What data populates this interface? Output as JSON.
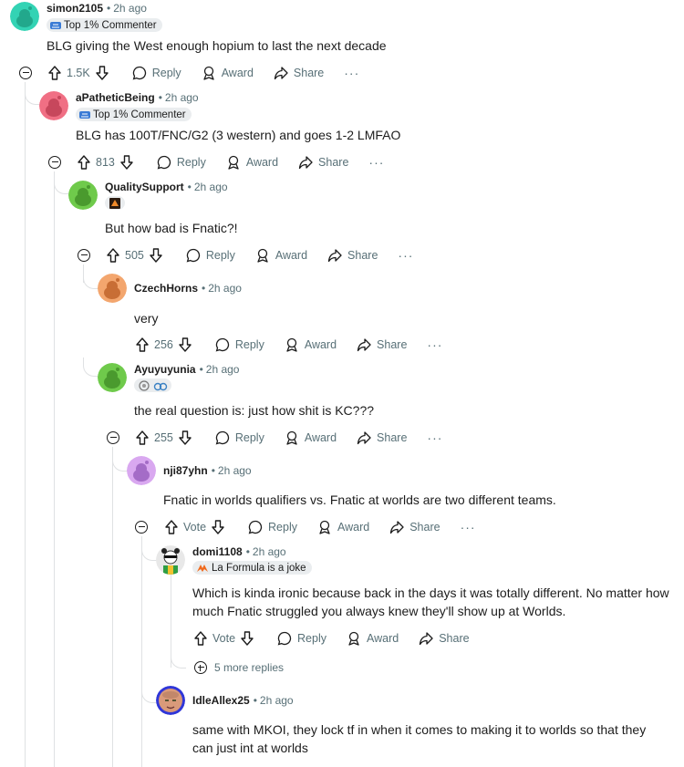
{
  "labels": {
    "reply": "Reply",
    "award": "Award",
    "share": "Share",
    "more": "···"
  },
  "comments": [
    {
      "user": "simon2105",
      "time": "2h ago",
      "flair": "Top 1% Commenter",
      "body": "BLG giving the West enough hopium to last the next decade",
      "votes": "1.5K",
      "avatar_color": "#33d3b4"
    },
    {
      "user": "aPatheticBeing",
      "time": "2h ago",
      "flair": "Top 1% Commenter",
      "body": "BLG has 100T/FNC/G2 (3 western) and goes 1-2 LMFAO",
      "votes": "813",
      "avatar_color": "#f06f84"
    },
    {
      "user": "QualitySupport",
      "time": "2h ago",
      "flair": "",
      "body": "But how bad is Fnatic?!",
      "votes": "505",
      "avatar_color": "#6fca4b"
    },
    {
      "user": "CzechHorns",
      "time": "2h ago",
      "flair": "",
      "body": "very",
      "votes": "256",
      "avatar_color": "#e9884d"
    },
    {
      "user": "Ayuyuyunia",
      "time": "2h ago",
      "flair": "",
      "body": "the real question is: just how shit is KC???",
      "votes": "255",
      "avatar_color": "#6fca4b"
    },
    {
      "user": "nji87yhn",
      "time": "2h ago",
      "flair": "",
      "body": "Fnatic in worlds qualifiers vs. Fnatic at worlds are two different teams.",
      "votes": "Vote",
      "avatar_color": "#c98ae6"
    },
    {
      "user": "domi1108",
      "time": "2h ago",
      "flair": "La Formula is a joke",
      "body": "Which is kinda ironic because back in the days it was totally different. No matter how much Fnatic struggled you always knew they'll show up at Worlds.",
      "votes": "Vote",
      "avatar_color": "#e8e8e8"
    },
    {
      "user": "IdleAllex25",
      "time": "2h ago",
      "flair": "",
      "body": "same with MKOI, they lock tf in when it comes to making it to worlds so that they can just int at worlds",
      "votes": "",
      "avatar_color": "#2f36d8"
    }
  ],
  "more_replies": "5 more replies"
}
